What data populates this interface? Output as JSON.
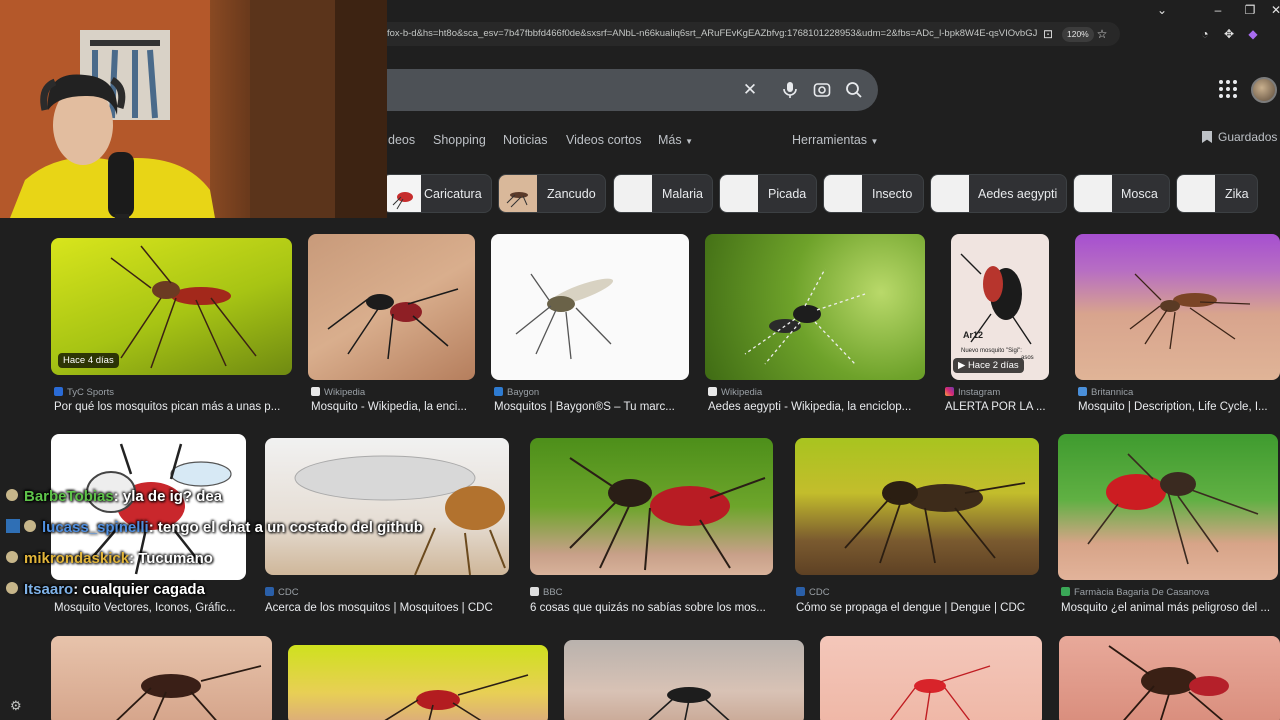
{
  "browser": {
    "url": "fox-b-d&hs=ht8o&sca_esv=7b47fbbfd466f0de&sxsrf=ANbL-n66kualiq6srt_ARuFEvKgEAZbfvg:1768101228953&udm=2&fbs=ADc_l-bpk8W4E-qsVIOvbGJcD",
    "zoom": "120%",
    "icons": [
      "chevron-down-icon",
      "minimize-icon",
      "maximize-icon",
      "close-icon",
      "install-icon",
      "zoom-icon",
      "star-icon",
      "sync-icon",
      "extensions-icon",
      "download-icon",
      "extension-icon"
    ]
  },
  "search": {
    "icons": [
      "clear-icon",
      "mic-icon",
      "lens-icon",
      "search-icon"
    ]
  },
  "nav": {
    "tabs": [
      "deos",
      "Shopping",
      "Noticias",
      "Videos cortos",
      "Más",
      "Herramientas"
    ],
    "saved": "Guardados"
  },
  "chips": [
    "Caricatura",
    "Zancudo",
    "Malaria",
    "Picada",
    "Insecto",
    "Aedes aegypti",
    "Mosca",
    "Zika"
  ],
  "results": [
    {
      "source": "TyC Sports",
      "title": "Por qué los mosquitos pican más a unas p...",
      "badge": "Hace 4 días"
    },
    {
      "source": "Wikipedia",
      "title": "Mosquito - Wikipedia, la enci...",
      "badge": ""
    },
    {
      "source": "Baygon",
      "title": "Mosquitos | Baygon®S – Tu marc...",
      "badge": ""
    },
    {
      "source": "Wikipedia",
      "title": "Aedes aegypti - Wikipedia, la enciclop...",
      "badge": ""
    },
    {
      "source": "Instagram",
      "title": "ALERTA POR LA ...",
      "badge": "▶ Hace 2 días",
      "image_text": [
        "Ar12",
        "Nuevo mosquito \"Sigi\":",
        "asos"
      ]
    },
    {
      "source": "Britannica",
      "title": "Mosquito | Description, Life Cycle, I...",
      "badge": ""
    },
    {
      "source": "",
      "title": "Mosquito Vectores, Iconos, Gráfic...",
      "badge": ""
    },
    {
      "source": "CDC",
      "title": "Acerca de los mosquitos | Mosquitoes | CDC",
      "badge": ""
    },
    {
      "source": "BBC",
      "title": "6 cosas que quizás no sabías sobre los mos...",
      "badge": ""
    },
    {
      "source": "CDC",
      "title": "Cómo se propaga el dengue | Dengue | CDC",
      "badge": ""
    },
    {
      "source": "Farmàcia Bagaria De Casanova",
      "title": "Mosquito ¿el animal más peligroso del ...",
      "badge": ""
    }
  ],
  "chat": [
    {
      "user": "BarbeTobias",
      "message": ": yla de ig? dea",
      "color": "#5ec34a"
    },
    {
      "user": "lucass_spinelli",
      "message": ": tengo el chat a un costado del github",
      "color": "#4f8fe0"
    },
    {
      "user": "mikrondaskick",
      "message": ": Tucumano",
      "color": "#e2b53a"
    },
    {
      "user": "Itsaaro",
      "message": ": cualquier cagada",
      "color": "#7fb2e8"
    }
  ],
  "colors": {
    "page_bg": "#1f1f1f",
    "chip_bg": "#303134",
    "accent": "#8ab4f8"
  }
}
